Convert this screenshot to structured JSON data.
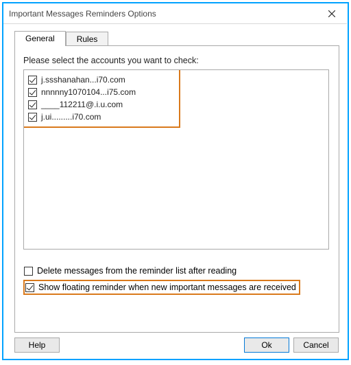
{
  "window": {
    "title": "Important Messages Reminders Options"
  },
  "tabs": {
    "general": "General",
    "rules": "Rules",
    "active": "general"
  },
  "general": {
    "prompt": "Please select the accounts you want to check:",
    "accounts": [
      {
        "checked": true,
        "label": "j.ssshanahan...i70.com"
      },
      {
        "checked": true,
        "label": "nnnnny1070104...i75.com"
      },
      {
        "checked": true,
        "label": "____112211@.i.u.com"
      },
      {
        "checked": true,
        "label": "j.ui.........i70.com"
      }
    ],
    "opt_delete": {
      "checked": false,
      "label": "Delete messages from the reminder list after reading"
    },
    "opt_floating": {
      "checked": true,
      "label": "Show floating reminder when new important messages are received"
    }
  },
  "buttons": {
    "help": "Help",
    "ok": "Ok",
    "cancel": "Cancel"
  }
}
